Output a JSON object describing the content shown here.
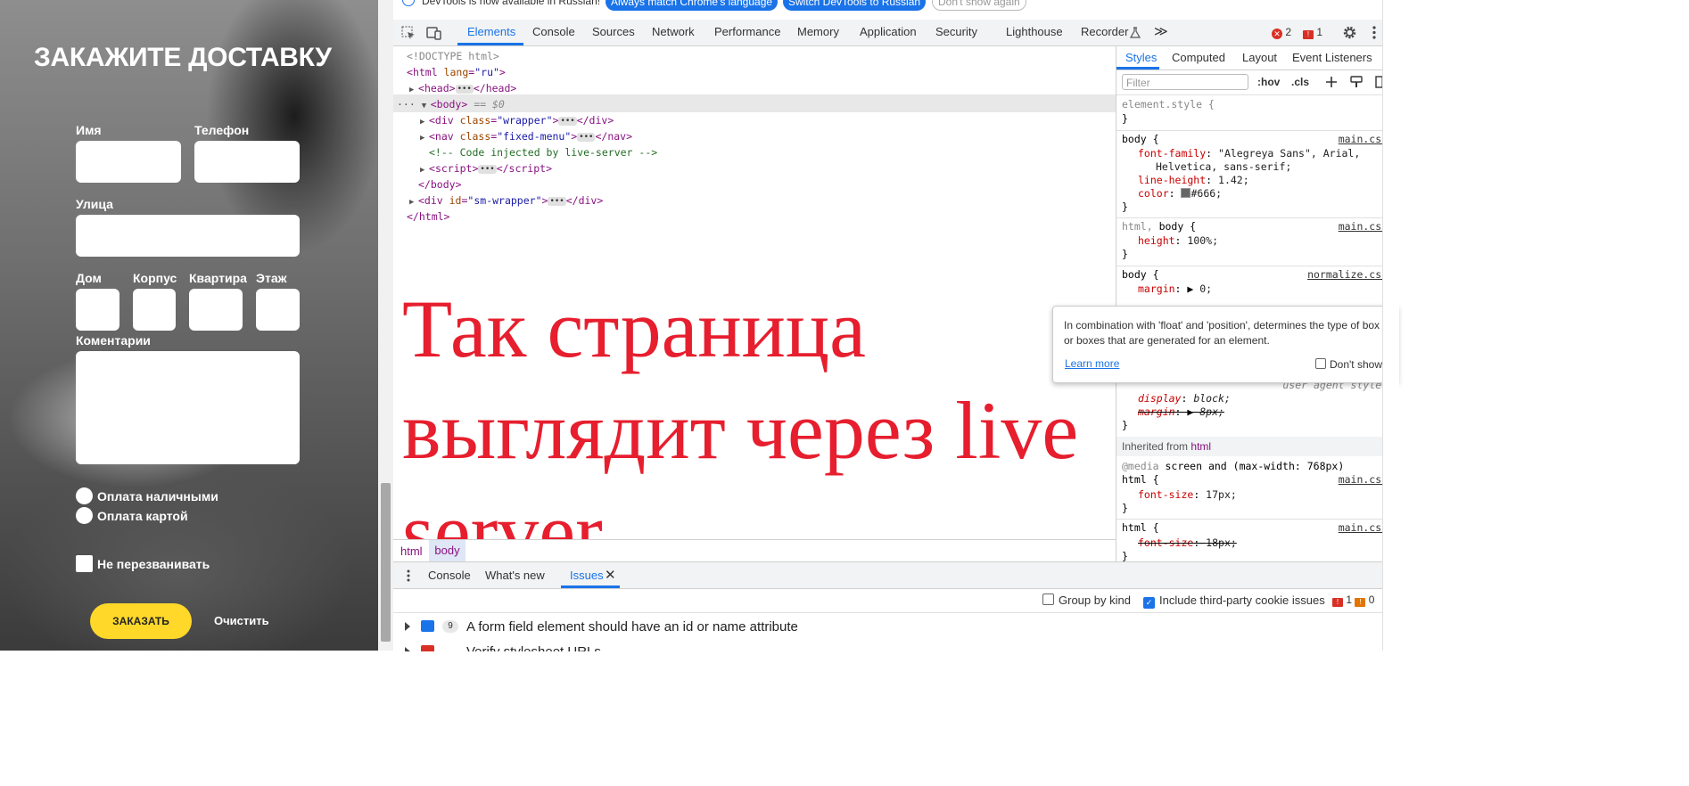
{
  "form": {
    "title": "ЗАКАЖИТЕ ДОСТАВКУ",
    "labels": {
      "name": "Имя",
      "phone": "Телефон",
      "street": "Улица",
      "house": "Дом",
      "building": "Корпус",
      "apartment": "Квартира",
      "floor": "Этаж",
      "comments": "Коментарии"
    },
    "payment_cash": "Оплата наличными",
    "payment_card": "Оплата картой",
    "no_callback": "Не перезванивать",
    "order_button": "ЗАКАЗАТЬ",
    "clear_button": "Очистить"
  },
  "devtools": {
    "infobar": {
      "message": "DevTools is now available in Russian!",
      "btn_match": "Always match Chrome's language",
      "btn_switch": "Switch DevTools to Russian",
      "btn_dont": "Don't show again"
    },
    "tabs": [
      "Elements",
      "Console",
      "Sources",
      "Network",
      "Performance",
      "Memory",
      "Application",
      "Security",
      "Lighthouse",
      "Recorder"
    ],
    "more": "≫",
    "errors": "2",
    "issues": "1",
    "dom": {
      "doctype": "<!DOCTYPE html>",
      "html_open_tag": "html",
      "html_lang_attr": "lang",
      "html_lang_val": "\"ru\"",
      "head": "head",
      "body": "body",
      "body_marker": "== $0",
      "div_wrapper_attr": "class",
      "div_wrapper_val": "\"wrapper\"",
      "nav_val": "\"fixed-menu\"",
      "comment": "<!-- Code injected by live-server -->",
      "script": "script",
      "body_close": "</body>",
      "div_sm_attr": "id",
      "div_sm_val": "\"sm-wrapper\"",
      "html_close": "</html>"
    },
    "overlay_text": "Так страница выглядит через live server",
    "breadcrumbs": [
      "html",
      "body"
    ],
    "styles": {
      "tabs": [
        "Styles",
        "Computed",
        "Layout",
        "Event Listeners"
      ],
      "filter_placeholder": "Filter",
      "hov": ":hov",
      "cls": ".cls",
      "element_style": "element.style {",
      "rule1_selector": "body {",
      "rule1_source": "main.css:",
      "rule1_p1": "font-family",
      "rule1_v1": "\"Alegreya Sans\", Arial,",
      "rule1_v1b": "Helvetica, sans-serif;",
      "rule1_p2": "line-height",
      "rule1_v2": "1.42;",
      "rule1_p3": "color",
      "rule1_v3": "#666;",
      "rule2_selector_a": "html,",
      "rule2_selector_b": "body {",
      "rule2_source": "main.css:",
      "rule2_p1": "height",
      "rule2_v1": "100%;",
      "rule3_selector": "body {",
      "rule3_source": "normalize.css:",
      "rule3_p1": "margin",
      "rule3_v1": "0;",
      "rule4_p1": "display",
      "rule4_v1": "block;",
      "rule4_p2": "margin",
      "rule4_v2": "8px;",
      "rule4_source": "user agent stylesh",
      "inherited_label": "Inherited from",
      "inherited_tag": "html",
      "media": "@media",
      "media_query": "screen and (max-width: 768px)",
      "rule5_selector": "html {",
      "rule5_source": "main.css:",
      "rule5_p1": "font-size",
      "rule5_v1": "17px;",
      "rule6_selector": "html {",
      "rule6_source": "main.css:",
      "rule6_p1": "font-size",
      "rule6_v1": "18px;"
    },
    "tooltip": {
      "text": "In combination with 'float' and 'position', determines the type of box or boxes that are generated for an element.",
      "learn_more": "Learn more",
      "dont_show": "Don't show"
    },
    "drawer": {
      "tabs": [
        "Console",
        "What's new",
        "Issues"
      ],
      "group_by_kind": "Group by kind",
      "include_third_party": "Include third-party cookie issues",
      "error_count": "1",
      "warning_count": "0",
      "issue1_count": "9",
      "issue1_text": "A form field element should have an id or name attribute",
      "issue2_text": "Verify stylesheet URLs"
    }
  }
}
